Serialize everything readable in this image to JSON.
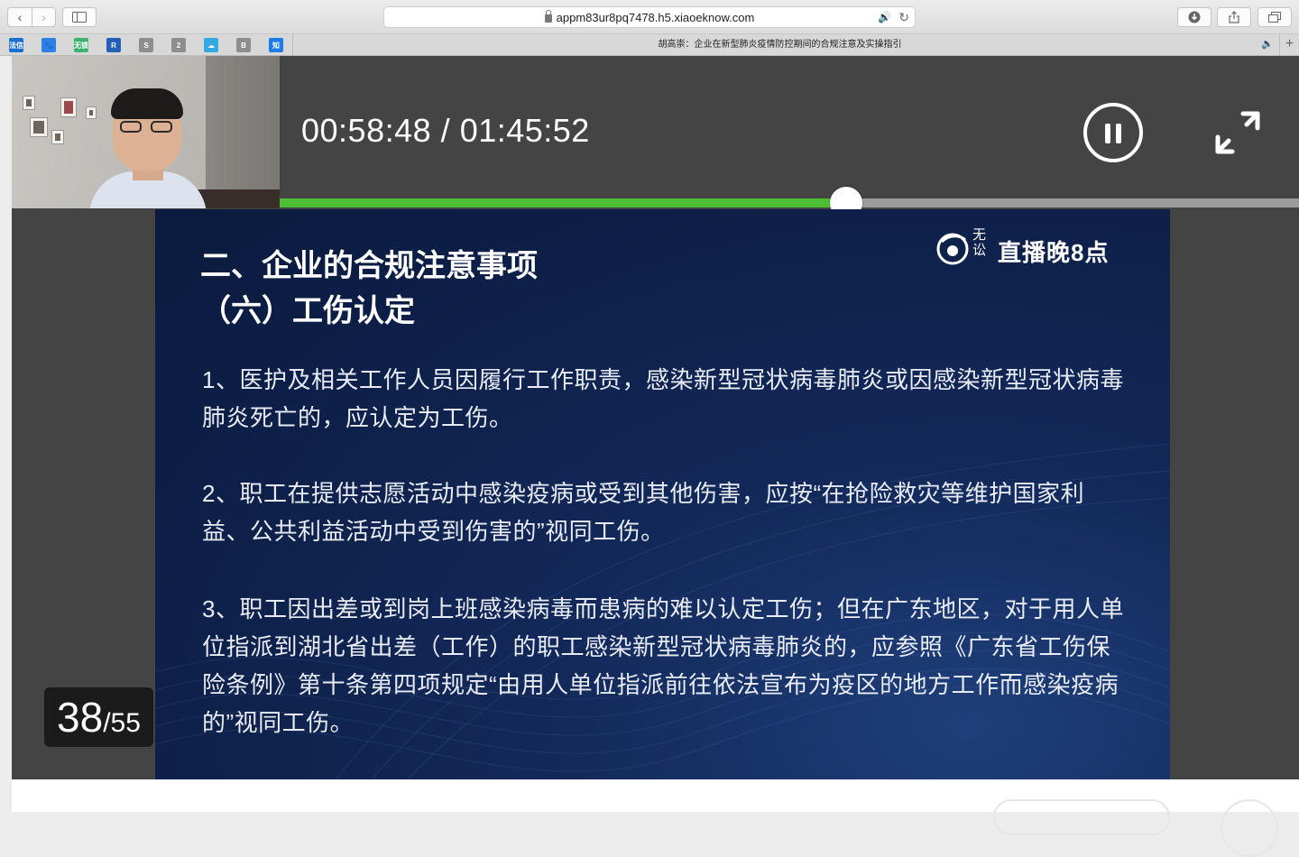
{
  "browser": {
    "url": "appm83ur8pq7478.h5.xiaoeknow.com",
    "tab_title": "胡高崇：企业在新型肺炎疫情防控期间的合规注意及实操指引",
    "favorites": [
      {
        "label": "法信",
        "color": "#1b6fcf"
      },
      {
        "label": "🐾",
        "color": "#2f7fe6"
      },
      {
        "label": "无锁",
        "color": "#3cb371"
      },
      {
        "label": "R",
        "color": "#2660b6"
      },
      {
        "label": "S",
        "color": "#8e8e8e"
      },
      {
        "label": "2",
        "color": "#8e8e8e"
      },
      {
        "label": "☁",
        "color": "#34a8e3"
      },
      {
        "label": "B",
        "color": "#8e8e8e"
      },
      {
        "label": "知",
        "color": "#1e7ce6"
      }
    ]
  },
  "player": {
    "time_current": "00:58:48",
    "time_separator": "/",
    "time_total": "01:45:52",
    "progress_fraction": 0.5555,
    "page_current": "38",
    "page_total": "/55"
  },
  "slide": {
    "heading": "二、企业的合规注意事项",
    "subheading": "（六）工伤认定",
    "brand_small": "无讼",
    "brand_text": "直播晚8点",
    "paragraphs": [
      "1、医护及相关工作人员因履行工作职责，感染新型冠状病毒肺炎或因感染新型冠状病毒肺炎死亡的，应认定为工伤。",
      "2、职工在提供志愿活动中感染疫病或受到其他伤害，应按“在抢险救灾等维护国家利益、公共利益活动中受到伤害的”视同工伤。",
      "3、职工因出差或到岗上班感染病毒而患病的难以认定工伤；但在广东地区，对于用人单位指派到湖北省出差（工作）的职工感染新型冠状病毒肺炎的，应参照《广东省工伤保险条例》第十条第四项规定“由用人单位指派前往依法宣布为疫区的地方工作而感染疫病的”视同工伤。"
    ]
  }
}
